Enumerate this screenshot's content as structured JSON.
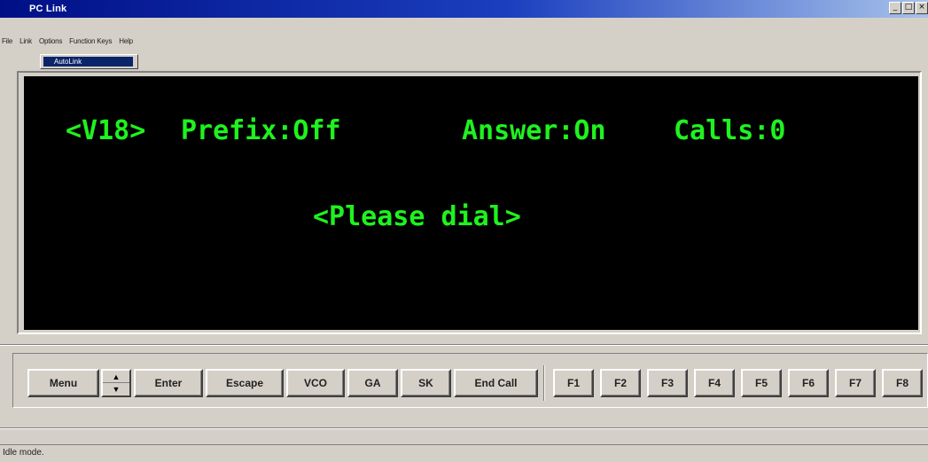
{
  "window": {
    "title": "PC Link",
    "controls": [
      "minimize-icon",
      "maximize-icon",
      "close-icon"
    ]
  },
  "menu": {
    "items": [
      "File",
      "Link",
      "Options",
      "Function Keys",
      "Help"
    ]
  },
  "dropdown": {
    "selected_item": "AutoLink"
  },
  "terminal": {
    "mode": "<V18>",
    "prefix": "Prefix:Off",
    "answer": "Answer:On",
    "calls": "Calls:0",
    "prompt": "<Please dial>",
    "text_color": "#1ff21f",
    "background": "#000000"
  },
  "toolbar": {
    "menu": "Menu",
    "enter": "Enter",
    "escape": "Escape",
    "vco": "VCO",
    "ga": "GA",
    "sk": "SK",
    "end_call": "End Call",
    "function_keys": [
      "F1",
      "F2",
      "F3",
      "F4",
      "F5",
      "F6",
      "F7",
      "F8"
    ]
  },
  "status": {
    "text": "Idle mode."
  },
  "colors": {
    "titlebar_start": "#000f86",
    "titlebar_end": "#a7c2eb",
    "face": "#d4d0c8"
  }
}
